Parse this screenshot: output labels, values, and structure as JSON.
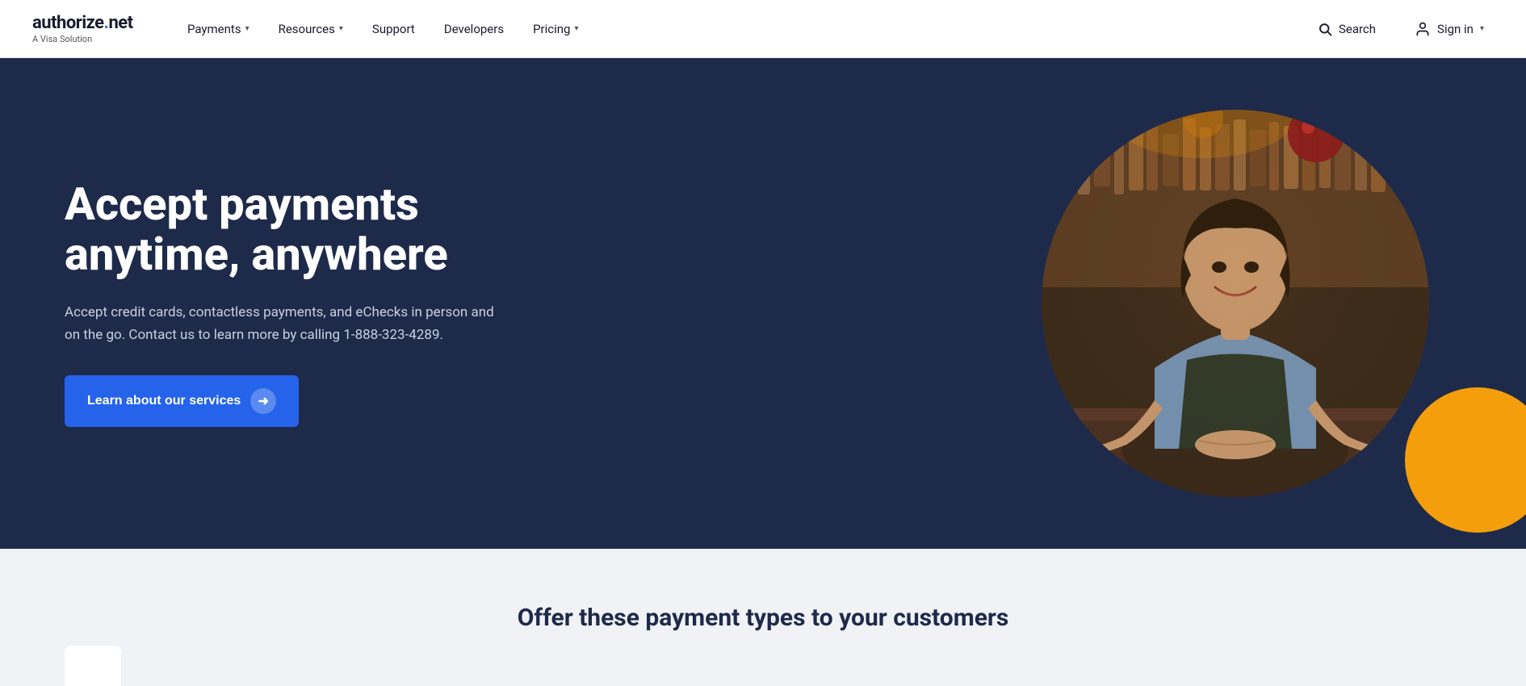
{
  "brand": {
    "name_part1": "authorize",
    "name_dot": ".",
    "name_part2": "net",
    "tagline": "A Visa Solution"
  },
  "nav": {
    "items": [
      {
        "label": "Payments",
        "has_dropdown": true
      },
      {
        "label": "Resources",
        "has_dropdown": true
      },
      {
        "label": "Support",
        "has_dropdown": false
      },
      {
        "label": "Developers",
        "has_dropdown": false
      },
      {
        "label": "Pricing",
        "has_dropdown": true
      }
    ],
    "search_label": "Search",
    "signin_label": "Sign in",
    "signin_has_dropdown": true
  },
  "hero": {
    "title": "Accept payments anytime, anywhere",
    "description": "Accept credit cards, contactless payments, and eChecks in person and on the go. Contact us to learn more by calling 1-888-323-4289.",
    "cta_label": "Learn about our services"
  },
  "bottom": {
    "title": "Offer these payment types to your customers"
  },
  "colors": {
    "nav_bg": "#ffffff",
    "hero_bg": "#1e2a4a",
    "cta_bg": "#2563eb",
    "bottom_bg": "#f0f2f5",
    "gold": "#f59e0b"
  }
}
